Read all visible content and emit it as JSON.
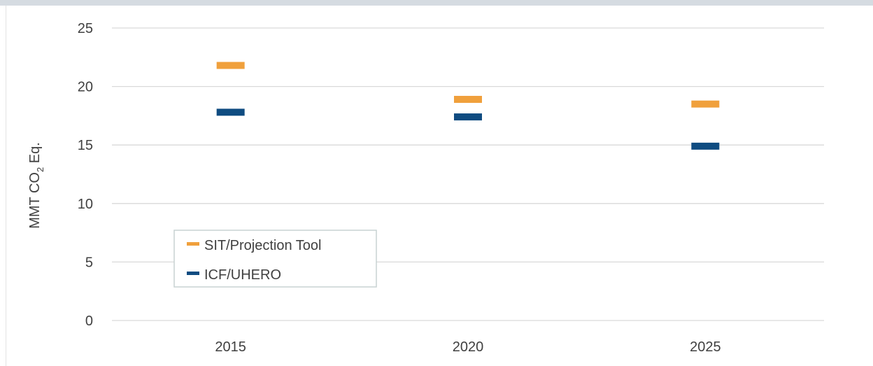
{
  "chart_data": {
    "type": "scatter",
    "marker": "dash",
    "categories": [
      "2015",
      "2020",
      "2025"
    ],
    "series": [
      {
        "name": "SIT/Projection Tool",
        "color": "#f0a03c",
        "values": [
          21.8,
          18.9,
          18.5
        ]
      },
      {
        "name": "ICF/UHERO",
        "color": "#0f4c81",
        "values": [
          17.8,
          17.4,
          14.9
        ]
      }
    ],
    "ylabel": "MMT CO2 Eq.",
    "ylabel_parts": {
      "pre": "MMT CO",
      "sub": "2",
      "post": " Eq."
    },
    "ylim": [
      0,
      25
    ],
    "yticks": [
      "0",
      "5",
      "10",
      "15",
      "20",
      "25"
    ],
    "grid": true,
    "legend_position": "lower-left"
  }
}
